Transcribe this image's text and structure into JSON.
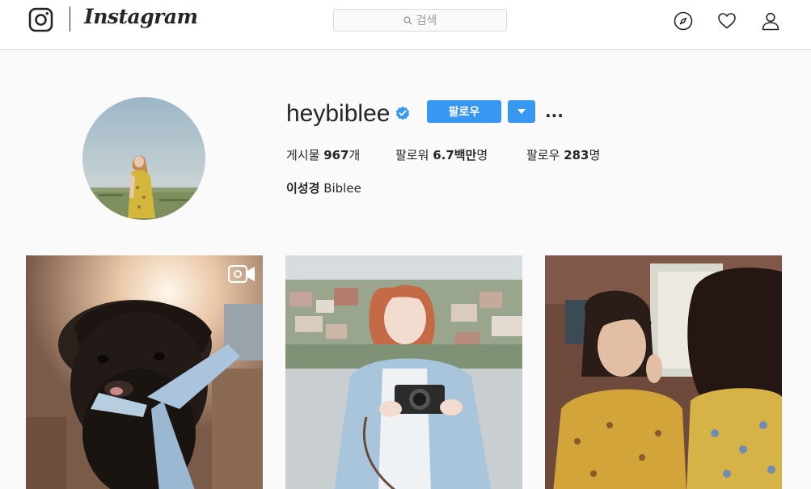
{
  "nav": {
    "logo": "instagram-logo",
    "wordmark": "Instagram",
    "search_placeholder": "검색",
    "icons": [
      "compass-icon",
      "heart-icon",
      "user-icon"
    ]
  },
  "profile": {
    "username": "heybiblee",
    "verified": true,
    "follow_label": "팔로우",
    "more_label": "...",
    "stats": {
      "posts_label": "게시물",
      "posts_value": "967",
      "posts_unit": "개",
      "followers_label": "팔로워",
      "followers_value": "6.7백만",
      "followers_unit": "명",
      "following_label": "팔로우",
      "following_value": "283",
      "following_unit": "명"
    },
    "full_name": "이성경",
    "full_name_en": "Biblee"
  },
  "posts": [
    {
      "type": "video",
      "subject": "black pug wearing a blue scarf"
    },
    {
      "type": "photo",
      "subject": "woman holding a camera"
    },
    {
      "type": "photo",
      "subject": "woman in yellow floral shirt"
    }
  ],
  "colors": {
    "accent": "#3897f0",
    "text": "#262626",
    "border": "#dbdbdb",
    "background": "#fafafa"
  }
}
